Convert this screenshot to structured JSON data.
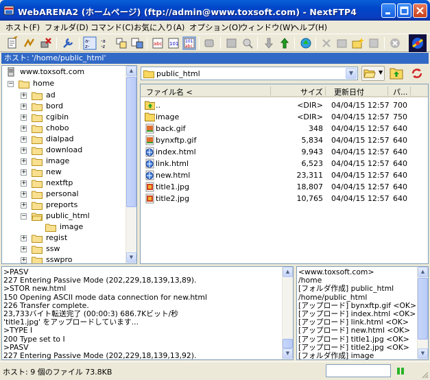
{
  "window": {
    "title": "WebARENA2 (ホームページ) (ftp://admin@www.toxsoft.com) - NextFTP4"
  },
  "menu": [
    "ホスト(F)",
    "フォルダ(D)",
    "コマンド(C)",
    "お気に入り(A)",
    "オプション(O)",
    "ウィンドウ(W)",
    "ヘルプ(H)"
  ],
  "host_bar": "ホスト: '/home/public_html'",
  "tree": {
    "root": "www.toxsoft.com",
    "home": "home",
    "folders": [
      "ad",
      "bord",
      "cgibin",
      "chobo",
      "dialpad",
      "download",
      "image",
      "new",
      "nextftp",
      "personal",
      "preports",
      "public_html",
      "regist",
      "ssw",
      "sswpro"
    ],
    "open_folder": "public_html",
    "child": "image"
  },
  "path_combo": "public_html",
  "columns": {
    "name": "ファイル名 <",
    "size": "サイズ",
    "date": "更新日付",
    "perm": "パ..."
  },
  "files": [
    {
      "name": "..",
      "size": "",
      "date": "",
      "perm": "",
      "icon": "up-folder-icon"
    },
    {
      "name": "image",
      "size": "<DIR>",
      "date": "04/04/15 12:57",
      "perm": "750",
      "icon": "folder-icon"
    },
    {
      "name": "back.gif",
      "size": "348",
      "date": "04/04/15 12:57",
      "perm": "640",
      "icon": "gif-icon"
    },
    {
      "name": "bynxftp.gif",
      "size": "5,834",
      "date": "04/04/15 12:57",
      "perm": "640",
      "icon": "gif-icon"
    },
    {
      "name": "index.html",
      "size": "9,943",
      "date": "04/04/15 12:57",
      "perm": "640",
      "icon": "html-icon"
    },
    {
      "name": "link.html",
      "size": "6,523",
      "date": "04/04/15 12:57",
      "perm": "640",
      "icon": "html-icon"
    },
    {
      "name": "new.html",
      "size": "23,311",
      "date": "04/04/15 12:57",
      "perm": "640",
      "icon": "html-icon"
    },
    {
      "name": "title1.jpg",
      "size": "18,807",
      "date": "04/04/15 12:57",
      "perm": "640",
      "icon": "jpg-icon"
    },
    {
      "name": "title2.jpg",
      "size": "10,765",
      "date": "04/04/15 12:57",
      "perm": "640",
      "icon": "jpg-icon"
    }
  ],
  "parent_dir_size": "<DIR>",
  "parent_dir_date": "04/04/15 12:57",
  "parent_dir_perm": "700",
  "log": [
    ">PASV",
    "227 Entering Passive Mode (202,229,18,139,13,89).",
    ">STOR new.html",
    "150 Opening ASCII mode data connection for new.html",
    "226 Transfer complete.",
    "23,733バイト転送完了 (00:00:3) 686.7Kビット/秒",
    "'title1.jpg' をアップロードしています...",
    ">TYPE I",
    "200 Type set to I",
    ">PASV",
    "227 Entering Passive Mode (202,229,18,139,13,92)."
  ],
  "log2": [
    "<www.toxsoft.com>",
    "/home",
    "[フォルダ作成] public_html",
    "/home/public_html",
    "[アップロード] bynxftp.gif <OK>",
    "[アップロード] index.html <OK>",
    "[アップロード] link.html <OK>",
    "[アップロード] new.html <OK>",
    "[アップロード] title1.jpg <OK>",
    "[アップロード] title2.jpg <OK>",
    "[フォルダ作成] image"
  ],
  "status": "ホスト: 9 個のファイル   73.8KB"
}
